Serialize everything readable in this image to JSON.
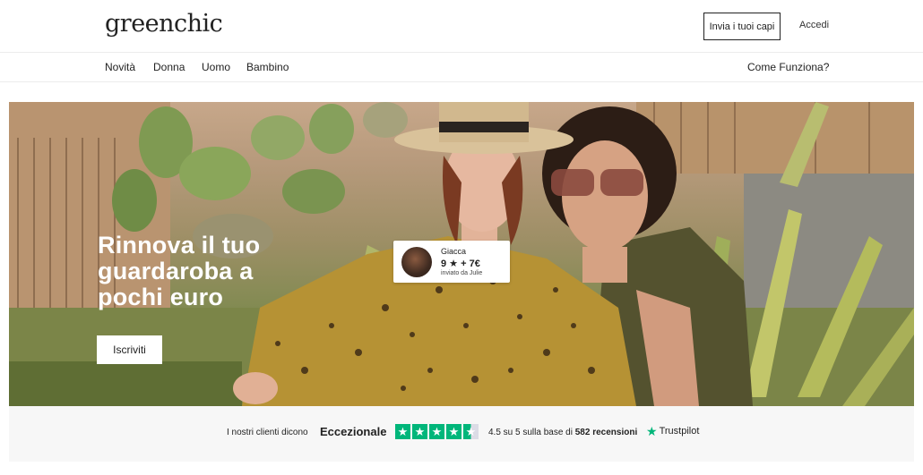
{
  "header": {
    "logo": "greenchic",
    "send_button": "Invia i tuoi capi",
    "login_link": "Accedi"
  },
  "nav": {
    "items": [
      "Novità",
      "Donna",
      "Uomo",
      "Bambino"
    ],
    "how_it_works": "Come Funziona?"
  },
  "hero": {
    "headline": "Rinnova il tuo guardaroba a pochi euro",
    "cta": "Iscriviti",
    "item_card": {
      "name": "Giacca",
      "price": "9 ★ + 7€",
      "sender": "inviato da Julie"
    }
  },
  "trust": {
    "intro": "I nostri clienti dicono",
    "rating_word": "Eccezionale",
    "stars": 4.5,
    "score_prefix": "4.5 su 5 sulla base di",
    "review_count": "582 recensioni",
    "brand": "Trustpilot",
    "brand_color": "#00b67a"
  }
}
